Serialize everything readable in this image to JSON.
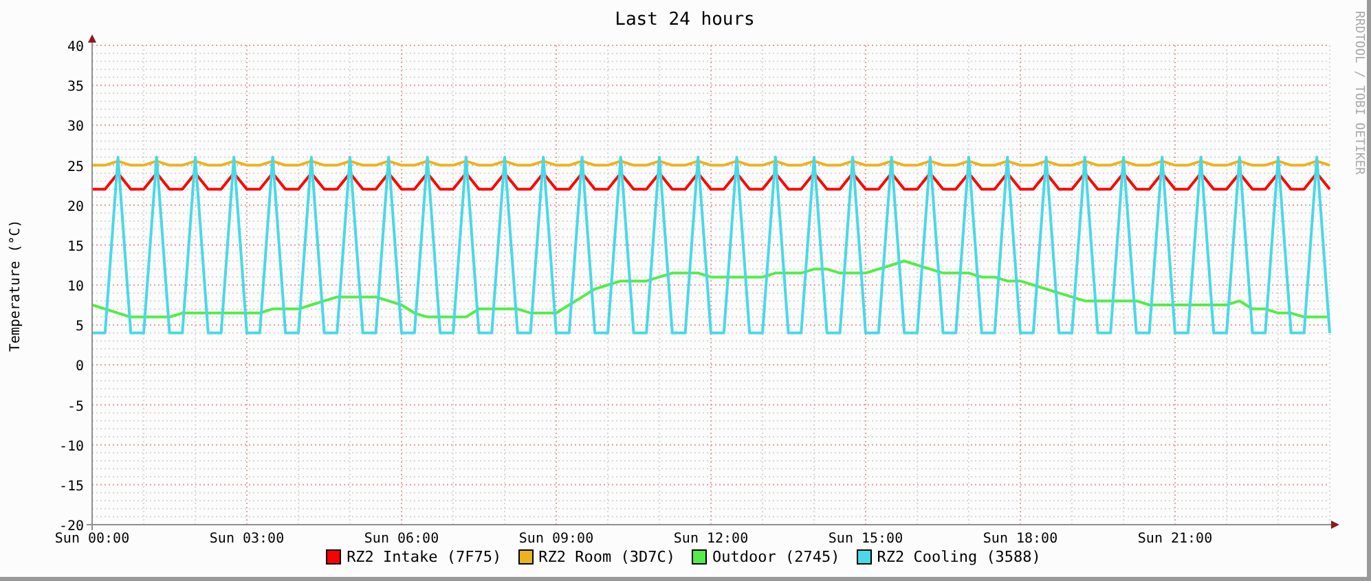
{
  "credit": "RRDTOOL / TOBI OETIKER",
  "chart_data": {
    "type": "line",
    "title": "Last 24 hours",
    "ylabel": "Temperature (°C)",
    "categories": [
      "Sun 00:00",
      null,
      null,
      null,
      null,
      null,
      null,
      null,
      null,
      null,
      null,
      null,
      "Sun 03:00",
      null,
      null,
      null,
      null,
      null,
      null,
      null,
      null,
      null,
      null,
      null,
      "Sun 06:00",
      null,
      null,
      null,
      null,
      null,
      null,
      null,
      null,
      null,
      null,
      null,
      "Sun 09:00",
      null,
      null,
      null,
      null,
      null,
      null,
      null,
      null,
      null,
      null,
      null,
      "Sun 12:00",
      null,
      null,
      null,
      null,
      null,
      null,
      null,
      null,
      null,
      null,
      null,
      "Sun 15:00",
      null,
      null,
      null,
      null,
      null,
      null,
      null,
      null,
      null,
      null,
      null,
      "Sun 18:00",
      null,
      null,
      null,
      null,
      null,
      null,
      null,
      null,
      null,
      null,
      null,
      "Sun 21:00",
      null,
      null,
      null,
      null,
      null,
      null,
      null,
      null,
      null,
      null,
      null,
      null
    ],
    "grid": true,
    "legend": "bottom",
    "ylim": [
      -20,
      40
    ],
    "yticks": [
      -20,
      -15,
      -10,
      -5,
      0,
      5,
      10,
      15,
      20,
      25,
      30,
      35,
      40
    ],
    "series": [
      {
        "name": "RZ2 Intake (7F75)",
        "color": "#ff0000",
        "values": [
          22,
          22,
          24,
          22,
          22,
          24,
          22,
          22,
          24,
          22,
          22,
          24,
          22,
          22,
          24,
          22,
          22,
          24,
          22,
          22,
          24,
          22,
          22,
          24,
          22,
          22,
          24,
          22,
          22,
          24,
          22,
          22,
          24,
          22,
          22,
          24,
          22,
          22,
          24,
          22,
          22,
          24,
          22,
          22,
          24,
          22,
          22,
          24,
          22,
          22,
          24,
          22,
          22,
          24,
          22,
          22,
          24,
          22,
          22,
          24,
          22,
          22,
          24,
          22,
          22,
          24,
          22,
          22,
          24,
          22,
          22,
          24,
          22,
          22,
          24,
          22,
          22,
          24,
          22,
          22,
          24,
          22,
          22,
          24,
          22,
          22,
          24,
          22,
          22,
          24,
          22,
          22,
          24,
          22,
          22,
          24,
          22
        ]
      },
      {
        "name": "RZ2 Room (3D7C)",
        "color": "#ecb31f",
        "values": [
          25,
          25,
          25.5,
          25,
          25,
          25.5,
          25,
          25,
          25.5,
          25,
          25,
          25.5,
          25,
          25,
          25.5,
          25,
          25,
          25.5,
          25,
          25,
          25.5,
          25,
          25,
          25.5,
          25,
          25,
          25.5,
          25,
          25,
          25.5,
          25,
          25,
          25.5,
          25,
          25,
          25.5,
          25,
          25,
          25.5,
          25,
          25,
          25.5,
          25,
          25,
          25.5,
          25,
          25,
          25.5,
          25,
          25,
          25.5,
          25,
          25,
          25.5,
          25,
          25,
          25.5,
          25,
          25,
          25.5,
          25,
          25,
          25.5,
          25,
          25,
          25.5,
          25,
          25,
          25.5,
          25,
          25,
          25.5,
          25,
          25,
          25.5,
          25,
          25,
          25.5,
          25,
          25,
          25.5,
          25,
          25,
          25.5,
          25,
          25,
          25.5,
          25,
          25,
          25.5,
          25,
          25,
          25.5,
          25,
          25,
          25.5,
          25
        ]
      },
      {
        "name": "Outdoor (2745)",
        "color": "#54ec48",
        "values": [
          7.5,
          7,
          6.5,
          6,
          6,
          6,
          6,
          6.5,
          6.5,
          6.5,
          6.5,
          6.5,
          6.5,
          6.5,
          7,
          7,
          7,
          7.5,
          8,
          8.5,
          8.5,
          8.5,
          8.5,
          8,
          7.5,
          6.5,
          6,
          6,
          6,
          6,
          7,
          7,
          7,
          7,
          6.5,
          6.5,
          6.5,
          7.5,
          8.5,
          9.5,
          10,
          10.5,
          10.5,
          10.5,
          11,
          11.5,
          11.5,
          11.5,
          11,
          11,
          11,
          11,
          11,
          11.5,
          11.5,
          11.5,
          12,
          12,
          11.5,
          11.5,
          11.5,
          12,
          12.5,
          13,
          12.5,
          12,
          11.5,
          11.5,
          11.5,
          11,
          11,
          10.5,
          10.5,
          10,
          9.5,
          9,
          8.5,
          8,
          8,
          8,
          8,
          8,
          7.5,
          7.5,
          7.5,
          7.5,
          7.5,
          7.5,
          7.5,
          8,
          7,
          7,
          6.5,
          6.5,
          6,
          6,
          6
        ]
      },
      {
        "name": "RZ2 Cooling (3588)",
        "color": "#48d9e8",
        "values": [
          4,
          4,
          26,
          4,
          4,
          26,
          4,
          4,
          26,
          4,
          4,
          26,
          4,
          4,
          26,
          4,
          4,
          26,
          4,
          4,
          26,
          4,
          4,
          26,
          4,
          4,
          26,
          4,
          4,
          26,
          4,
          4,
          26,
          4,
          4,
          26,
          4,
          4,
          26,
          4,
          4,
          26,
          4,
          4,
          26,
          4,
          4,
          26,
          4,
          4,
          26,
          4,
          4,
          26,
          4,
          4,
          26,
          4,
          4,
          26,
          4,
          4,
          26,
          4,
          4,
          26,
          4,
          4,
          26,
          4,
          4,
          26,
          4,
          4,
          26,
          4,
          4,
          26,
          4,
          4,
          26,
          4,
          4,
          26,
          4,
          4,
          26,
          4,
          4,
          26,
          4,
          4,
          26,
          4,
          4,
          26,
          4
        ]
      }
    ]
  }
}
